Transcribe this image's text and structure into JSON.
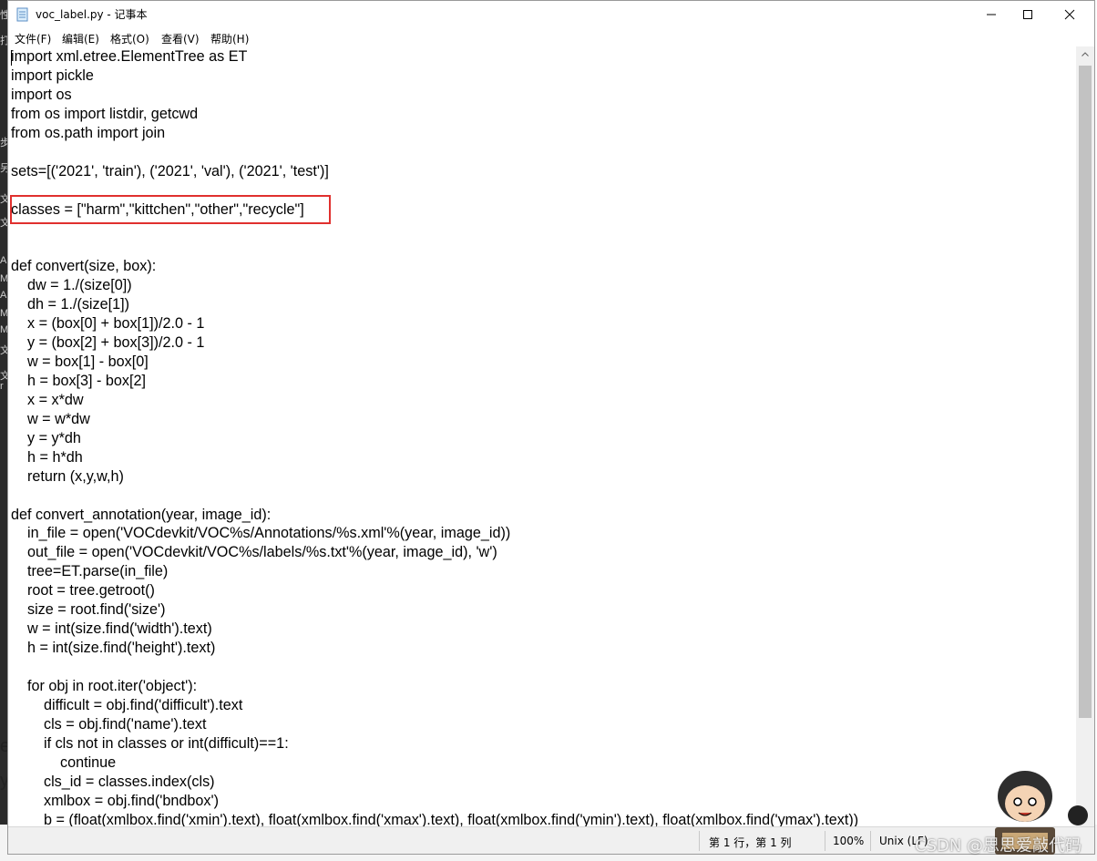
{
  "window": {
    "title": "voc_label.py - 记事本"
  },
  "menu": [
    "文件(F)",
    "编辑(E)",
    "格式(O)",
    "查看(V)",
    "帮助(H)"
  ],
  "editor": {
    "lines": [
      "import xml.etree.ElementTree as ET",
      "import pickle",
      "import os",
      "from os import listdir, getcwd",
      "from os.path import join",
      "",
      "sets=[('2021', 'train'), ('2021', 'val'), ('2021', 'test')]",
      "",
      "classes = [\"harm\",\"kittchen\",\"other\",\"recycle\"]",
      "",
      "",
      "def convert(size, box):",
      "    dw = 1./(size[0])",
      "    dh = 1./(size[1])",
      "    x = (box[0] + box[1])/2.0 - 1",
      "    y = (box[2] + box[3])/2.0 - 1",
      "    w = box[1] - box[0]",
      "    h = box[3] - box[2]",
      "    x = x*dw",
      "    w = w*dw",
      "    y = y*dh",
      "    h = h*dh",
      "    return (x,y,w,h)",
      "",
      "def convert_annotation(year, image_id):",
      "    in_file = open('VOCdevkit/VOC%s/Annotations/%s.xml'%(year, image_id))",
      "    out_file = open('VOCdevkit/VOC%s/labels/%s.txt'%(year, image_id), 'w')",
      "    tree=ET.parse(in_file)",
      "    root = tree.getroot()",
      "    size = root.find('size')",
      "    w = int(size.find('width').text)",
      "    h = int(size.find('height').text)",
      "",
      "    for obj in root.iter('object'):",
      "        difficult = obj.find('difficult').text",
      "        cls = obj.find('name').text",
      "        if cls not in classes or int(difficult)==1:",
      "            continue",
      "        cls_id = classes.index(cls)",
      "        xmlbox = obj.find('bndbox')",
      "        b = (float(xmlbox.find('xmin').text), float(xmlbox.find('xmax').text), float(xmlbox.find('ymin').text), float(xmlbox.find('ymax').text))"
    ]
  },
  "status": {
    "position": "第 1 行，第 1 列",
    "zoom": "100%",
    "encoding": "Unix (LF)"
  },
  "watermark": "CSDN @思思爱敲代码",
  "background_chars": [
    "性",
    "打",
    "步",
    "另",
    "文",
    "文",
    "A",
    "M",
    "A",
    "M",
    "M",
    "文",
    "文",
    "r",
    "e",
    "y"
  ],
  "colors": {
    "highlight": "#e0302e",
    "scroll_thumb": "#c2c2c2"
  }
}
